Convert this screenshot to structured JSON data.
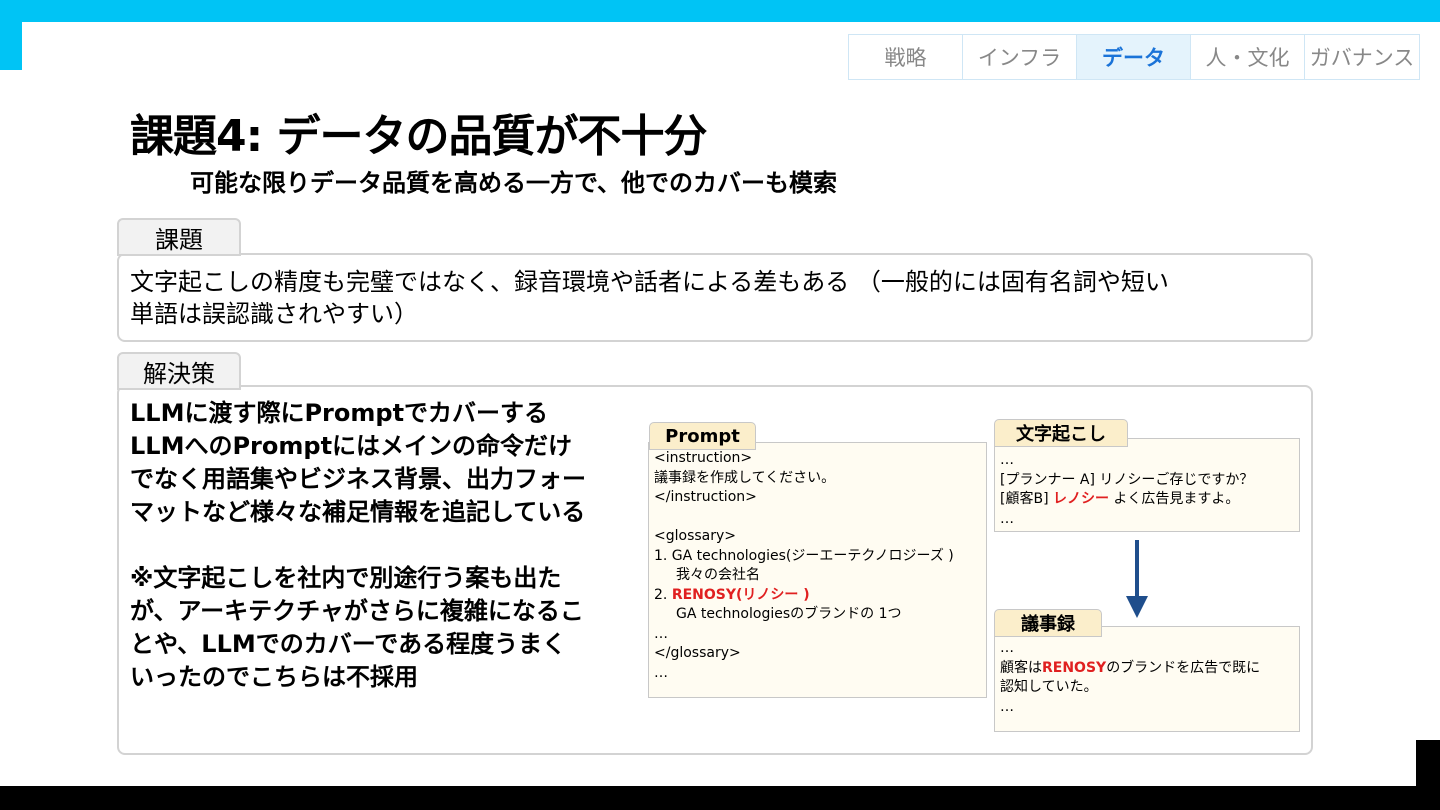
{
  "nav": {
    "tabs": [
      {
        "label": "戦略"
      },
      {
        "label": "インフラ"
      },
      {
        "label": "データ"
      },
      {
        "label": "人・文化"
      },
      {
        "label": "ガバナンス"
      }
    ],
    "active_index": 2
  },
  "title": "課題4:  データの品質が不十分",
  "subtitle": "可能な限りデータ品質を高める一方で、他でのカバーも模索",
  "problem": {
    "label": "課題",
    "lines": [
      "文字起こしの精度も完璧ではなく、録音環境や話者による差もある （一般的には固有名詞や短い",
      "単語は誤認識されやすい）"
    ]
  },
  "solution": {
    "label": "解決策",
    "lines": [
      "LLMに渡す際にPromptでカバーする",
      "LLMへのPromptにはメインの命令だけ",
      "でなく用語集やビジネス背景、出力フォー",
      "マットなど様々な補足情報を追記している"
    ],
    "note_lines": [
      "※文字起こしを社内で別途行う案も出た",
      "が、アーキテクチャがさらに複雑になるこ",
      "とや、LLMでのカバーである程度うまく",
      "いったのでこちらは不採用"
    ]
  },
  "prompt_panel": {
    "label": "Prompt",
    "l1": "<instruction>",
    "l2": "議事録を作成してください。",
    "l3": "</instruction>",
    "l4": "<glossary>",
    "l5": "1. GA technologies(ジーエーテクノロジーズ )",
    "l6": "我々の会社名",
    "l7_prefix": "2. ",
    "l7_red": "RENOSY(リノシー )",
    "l8": "GA technologiesのブランドの 1つ",
    "l9": "…",
    "l10": "</glossary>",
    "l11": "…"
  },
  "transcript_panel": {
    "label": "文字起こし",
    "l1": "…",
    "l2": "[プランナー A] リノシーご存じですか？",
    "l3_prefix": "[顧客B] ",
    "l3_red": "レノシー",
    "l3_suffix": " よく広告見ますよ。",
    "l4": "…"
  },
  "minutes_panel": {
    "label": "議事録",
    "l1": "…",
    "l2_prefix": "顧客は",
    "l2_red": "RENOSY",
    "l2_suffix": "のブランドを広告で既に",
    "l3": "認知していた。",
    "l4": "…"
  },
  "colors": {
    "accent": "#00c4f5",
    "active_tab": "#1a73d8",
    "highlight": "#e02020",
    "arrow": "#1f4e8c"
  }
}
